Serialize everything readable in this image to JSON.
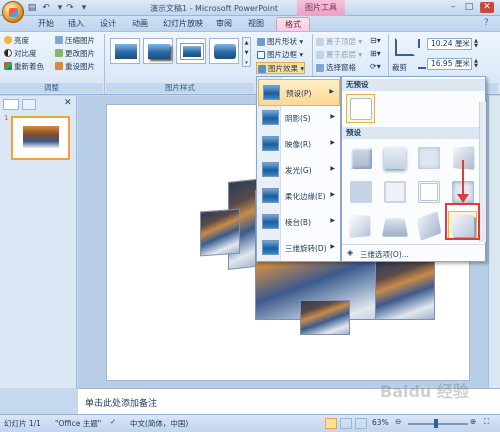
{
  "window": {
    "title": "演示文稿1 - Microsoft PowerPoint",
    "context_title": "图片工具",
    "quick_access": [
      "save-icon",
      "undo-icon",
      "redo-icon"
    ]
  },
  "tabs": [
    "开始",
    "插入",
    "设计",
    "动画",
    "幻灯片放映",
    "审阅",
    "视图"
  ],
  "active_tab": "格式",
  "ribbon": {
    "adjust": {
      "items": [
        "亮度",
        "对比度",
        "重新着色"
      ],
      "items_right": [
        "压缩图片",
        "更改图片",
        "重设图片"
      ],
      "label": "调整"
    },
    "picture_styles": {
      "label": "图片样式",
      "buttons": [
        "图片形状",
        "图片边框",
        "图片效果"
      ]
    },
    "arrange": {
      "items": [
        "置于顶层",
        "置于底层",
        "选择窗格"
      ]
    },
    "size": {
      "crop_label": "裁剪",
      "height": "10.24 厘米",
      "width": "16.95 厘米"
    }
  },
  "effects_menu": {
    "items": [
      {
        "label": "预设(P)",
        "active": true
      },
      {
        "label": "阴影(S)"
      },
      {
        "label": "映像(R)"
      },
      {
        "label": "发光(G)"
      },
      {
        "label": "柔化边缘(E)"
      },
      {
        "label": "棱台(B)"
      },
      {
        "label": "三维旋转(D)"
      }
    ]
  },
  "bevel_gallery": {
    "no_preset_header": "无预设",
    "preset_header": "预设",
    "more_options": "三维选项(O)..."
  },
  "thumbnail": {
    "number": "1"
  },
  "notes": {
    "placeholder": "单击此处添加备注"
  },
  "status": {
    "slide": "幻灯片 1/1",
    "theme": "\"Office 主题\"",
    "language": "中文(简体，中国)",
    "zoom": "63%"
  },
  "watermark": "Baidu 经验"
}
